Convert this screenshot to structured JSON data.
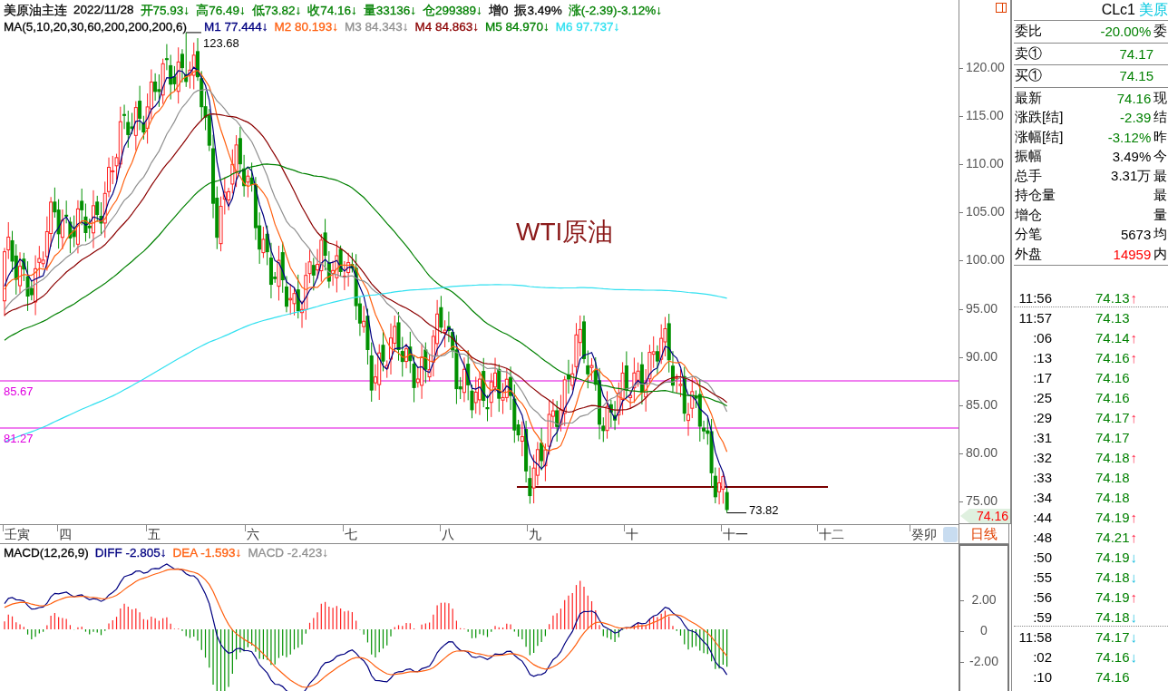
{
  "header": {
    "items": [
      {
        "text": "美原油主连",
        "color": "#000000"
      },
      {
        "text": "2022/11/28",
        "color": "#000000"
      },
      {
        "text": "开75.93↓",
        "color": "#008000"
      },
      {
        "text": "高76.49↓",
        "color": "#008000"
      },
      {
        "text": "低73.82↓",
        "color": "#008000"
      },
      {
        "text": "收74.16↓",
        "color": "#008000"
      },
      {
        "text": "量33136↓",
        "color": "#008000"
      },
      {
        "text": "仓299389↓",
        "color": "#008000"
      },
      {
        "text": "增0",
        "color": "#000000"
      },
      {
        "text": "振3.49%",
        "color": "#000000"
      },
      {
        "text": "涨(-2.39)-3.12%↓",
        "color": "#008000"
      }
    ]
  },
  "ma_legend": {
    "title": "MA(5,10,20,30,60,200,200,200,6)",
    "items": [
      {
        "label": "M1",
        "value": "77.444↓",
        "color": "#000080"
      },
      {
        "label": "M2",
        "value": "80.193↓",
        "color": "#ff6010"
      },
      {
        "label": "M3",
        "value": "84.343↓",
        "color": "#909090"
      },
      {
        "label": "M4",
        "value": "84.863↓",
        "color": "#8b0000"
      },
      {
        "label": "M5",
        "value": "84.970↓",
        "color": "#008000"
      },
      {
        "label": "M6",
        "value": "97.737↓",
        "color": "#30e0f0"
      }
    ]
  },
  "chart_labels": {
    "title": "WTI原油",
    "high": "123.68",
    "low": "73.82",
    "last_price": "74.16"
  },
  "price_lines": [
    {
      "label": "85.67"
    },
    {
      "label": "81.27"
    }
  ],
  "price_axis": [
    "120.00",
    "115.00",
    "110.00",
    "105.00",
    "100.00",
    "95.00",
    "90.00",
    "85.00",
    "80.00",
    "75.00"
  ],
  "date_axis": [
    "壬寅",
    "四",
    "五",
    "六",
    "七",
    "八",
    "九",
    "十",
    "十一",
    "十二",
    "癸卯"
  ],
  "period_button": "日线",
  "macd_legend": {
    "title": "MACD(12,26,9)",
    "items": [
      {
        "label": "DIFF",
        "value": "-2.805↓",
        "color": "#000080"
      },
      {
        "label": "DEA",
        "value": "-1.593↓",
        "color": "#ff6010"
      },
      {
        "label": "MACD",
        "value": "-2.423↓",
        "color": "#909090"
      }
    ]
  },
  "macd_axis": [
    "2.00",
    "0",
    "-2.00"
  ],
  "quote": {
    "code": "CLc1",
    "name": "美原",
    "sections": [
      {
        "rows": [
          {
            "label": "委比",
            "value": "-20.00%",
            "color": "#008000",
            "extra": "委"
          }
        ]
      },
      {
        "rows": [
          {
            "label": "卖①",
            "value": "74.17",
            "color": "#008000"
          }
        ]
      },
      {
        "rows": [
          {
            "label": "买①",
            "value": "74.15",
            "color": "#008000"
          }
        ]
      },
      {
        "rows": [
          {
            "label": "最新",
            "value": "74.16",
            "color": "#008000",
            "extra": "现"
          },
          {
            "label": "涨跌[结]",
            "value": "-2.39",
            "color": "#008000",
            "extra": "结"
          },
          {
            "label": "涨幅[结]",
            "value": "-3.12%",
            "color": "#008000",
            "extra": "昨"
          },
          {
            "label": "振幅",
            "value": "3.49%",
            "color": "#000000",
            "extra": "今"
          },
          {
            "label": "总手",
            "value": "3.31万",
            "color": "#000000",
            "extra": "最"
          },
          {
            "label": "持仓量",
            "extra": "最"
          },
          {
            "label": "增仓",
            "extra": "量"
          },
          {
            "label": "分笔",
            "value": "5673",
            "color": "#000000",
            "extra": "均"
          },
          {
            "label": "外盘",
            "value": "14959",
            "color": "#ff0000",
            "extra": "内"
          }
        ]
      }
    ]
  },
  "ticks": [
    {
      "time": "11:56",
      "price": "74.13",
      "arrow": "↑",
      "kind": "up",
      "group_start": false
    },
    {
      "time": "11:57",
      "price": "74.13",
      "group_start": true
    },
    {
      "time": ":06",
      "price": "74.14",
      "arrow": "↑",
      "kind": "up",
      "group_start": false
    },
    {
      "time": ":13",
      "price": "74.16",
      "arrow": "↑",
      "kind": "up",
      "group_start": false
    },
    {
      "time": ":17",
      "price": "74.16",
      "group_start": false
    },
    {
      "time": ":25",
      "price": "74.16",
      "group_start": false
    },
    {
      "time": ":29",
      "price": "74.17",
      "arrow": "↑",
      "kind": "up",
      "group_start": false
    },
    {
      "time": ":31",
      "price": "74.17",
      "group_start": false
    },
    {
      "time": ":32",
      "price": "74.18",
      "arrow": "↑",
      "kind": "up",
      "group_start": false
    },
    {
      "time": ":33",
      "price": "74.18",
      "group_start": false
    },
    {
      "time": ":34",
      "price": "74.18",
      "group_start": false
    },
    {
      "time": ":44",
      "price": "74.19",
      "arrow": "↑",
      "kind": "up",
      "group_start": false
    },
    {
      "time": ":48",
      "price": "74.21",
      "arrow": "↑",
      "kind": "up",
      "group_start": false
    },
    {
      "time": ":50",
      "price": "74.19",
      "arrow": "↓",
      "kind": "down",
      "group_start": false
    },
    {
      "time": ":55",
      "price": "74.18",
      "arrow": "↓",
      "kind": "down",
      "group_start": false
    },
    {
      "time": ":56",
      "price": "74.19",
      "arrow": "↑",
      "kind": "up",
      "group_start": false
    },
    {
      "time": ":59",
      "price": "74.18",
      "arrow": "↓",
      "kind": "down",
      "group_start": false
    },
    {
      "time": "11:58",
      "price": "74.17",
      "arrow": "↓",
      "kind": "down",
      "group_start": true
    },
    {
      "time": ":02",
      "price": "74.16",
      "arrow": "↓",
      "kind": "down",
      "group_start": false
    },
    {
      "time": ":10",
      "price": "74.16",
      "group_start": false
    }
  ]
}
